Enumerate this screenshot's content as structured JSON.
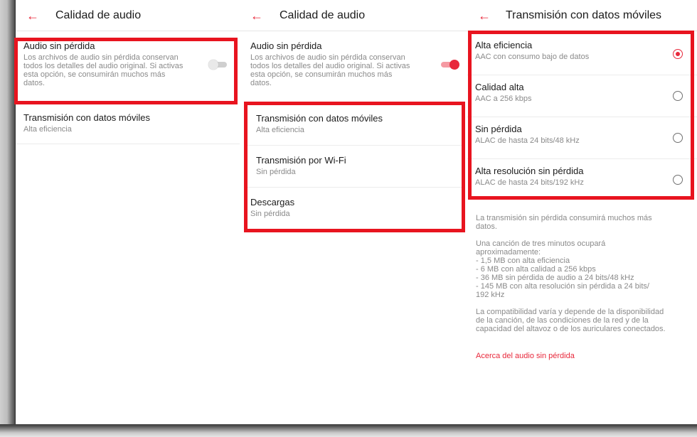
{
  "panel1": {
    "title": "Calidad de audio",
    "lossless": {
      "title": "Audio sin pérdida",
      "description_lines": [
        "Los archivos de audio sin pérdida conservan",
        "todos los detalles del audio original. Si activas",
        "esta opción, se consumirán muchos más",
        "datos."
      ],
      "toggle_on": false
    },
    "mobile": {
      "title": "Transmisión con datos móviles",
      "value": "Alta eficiencia"
    }
  },
  "panel2": {
    "title": "Calidad de audio",
    "lossless": {
      "title": "Audio sin pérdida",
      "description_lines": [
        "Los archivos de audio sin pérdida conservan",
        "todos los detalles del audio original. Si activas",
        "esta opción, se consumirán muchos más",
        "datos."
      ],
      "toggle_on": true
    },
    "items": [
      {
        "title": "Transmisión con datos móviles",
        "value": "Alta eficiencia"
      },
      {
        "title": "Transmisión por Wi-Fi",
        "value": "Sin pérdida"
      },
      {
        "title": "Descargas",
        "value": "Sin pérdida"
      }
    ]
  },
  "panel3": {
    "title": "Transmisión con datos móviles",
    "options": [
      {
        "title": "Alta eficiencia",
        "sub": "AAC con consumo bajo de datos",
        "selected": true
      },
      {
        "title": "Calidad alta",
        "sub": "AAC a 256 kbps",
        "selected": false
      },
      {
        "title": "Sin pérdida",
        "sub": "ALAC de hasta 24 bits/48 kHz",
        "selected": false
      },
      {
        "title": "Alta resolución sin pérdida",
        "sub": "ALAC de hasta 24 bits/192 kHz",
        "selected": false
      }
    ],
    "info1_lines": [
      "La transmisión sin pérdida consumirá muchos más",
      "datos."
    ],
    "info2_lines": [
      "Una canción de tres minutos ocupará",
      "aproximadamente:",
      "- 1,5 MB con alta eficiencia",
      "- 6 MB con alta calidad a 256 kbps",
      "- 36 MB sin pérdida de audio a 24 bits/48 kHz",
      "- 145 MB con alta resolución sin pérdida a 24 bits/",
      "192 kHz"
    ],
    "info3_lines": [
      "La compatibilidad varía y depende de la disponibilidad",
      "de la canción, de las condiciones de la red y de la",
      "capacidad del altavoz o de los auriculares conectados."
    ],
    "link": "Acerca del audio sin pérdida"
  },
  "icons": {
    "back": "arrow-left-icon"
  },
  "colors": {
    "accent": "#e8283b",
    "highlight": "#e8141f"
  }
}
